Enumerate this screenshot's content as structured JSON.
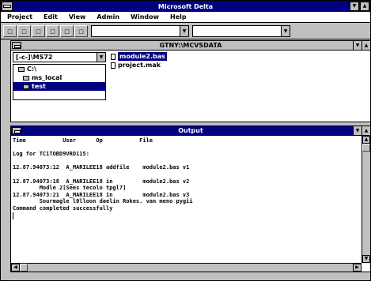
{
  "window": {
    "title": "Microsoft Delta"
  },
  "menu": [
    "Project",
    "Edit",
    "View",
    "Admin",
    "Window",
    "Help"
  ],
  "toolbar": {
    "buttons": [
      "",
      "",
      "",
      "",
      "",
      ""
    ],
    "combo1_value": "",
    "combo2_value": ""
  },
  "project": {
    "title": "GTNY:\\MCVSDATA",
    "drive": "[-c-]\\MS72",
    "dirs": [
      {
        "label": "C:\\",
        "selected": false
      },
      {
        "label": "ms_local",
        "selected": false
      },
      {
        "label": "test",
        "selected": true
      }
    ],
    "files": [
      {
        "label": "module2.bas",
        "selected": true
      },
      {
        "label": "project.mak",
        "selected": false
      }
    ]
  },
  "output": {
    "title": "Output",
    "lines": [
      "Time           User      Op           File",
      "",
      "Log for TC1TOBD9VRD115:",
      "",
      "12.87.94073:12  A_MARILEE18 addfile    module2.bas v1",
      "",
      "12.87.94073:18  A_MARILEE18 in         module2.bas v2",
      "        Modle 2[Sees tecolo tpgl7]",
      "12.87.94073:21  A_MARILEE18 in         module2.bas v3",
      "        Sourmagle l0lloon daelin Rokes. van meno pygii",
      "Command completed successfully"
    ]
  },
  "colors": {
    "titlebar": "#000080",
    "face": "#c0c0c0",
    "window": "#ffffff"
  }
}
